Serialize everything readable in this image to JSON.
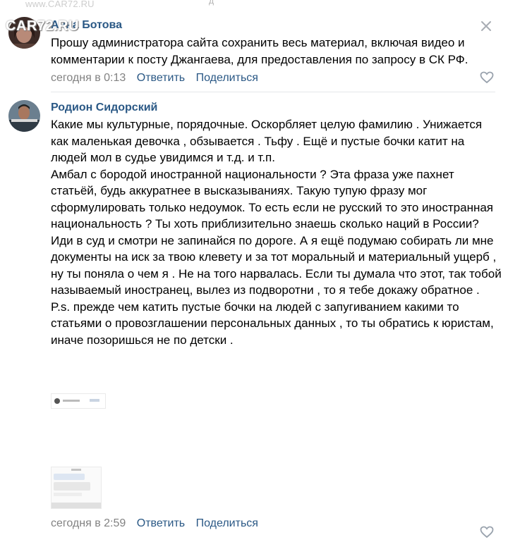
{
  "watermark": {
    "url": "www.CAR72.RU",
    "logo": "CAR72.RU"
  },
  "comments": [
    {
      "author": "Анна Ботова",
      "paragraphs": [
        "Прошу администратора сайта сохранить весь материал, включая видео и комментарии к посту Джангаева, для предоставления по запросу в СК РФ."
      ],
      "time": "сегодня в 0:13",
      "reply": "Ответить",
      "share": "Поделиться"
    },
    {
      "author": "Родион Сидорский",
      "paragraphs": [
        "Какие мы культурные, порядочные. Оскорбляет целую фамилию . Унижается как маленькая девочка , обзывается . Тьфу . Ещё и пустые бочки катит на людей мол в судье увидимся и т.д. и т.п.",
        "Амбал с бородой иностранной национальности ? Эта фраза уже пахнет статьёй, будь аккуратнее в высказываниях. Такую тупую фразу мог сформулировать только недоумок. То есть если не русский то это иностранная национальность ? Ты хоть приблизительно знаешь сколько наций в России?",
        "Иди в суд и смотри не запинайся по дороге. А я ещё подумаю собирать ли мне документы на иск за твою клевету и за тот моральный и материальный ущерб , ну ты поняла о чем я . Не на того нарвалась. Если ты думала что этот, так тобой называемый иностранец, вылез из подворотни , то я тебе докажу обратное .",
        "P.s. прежде чем катить пустые бочки на людей с запугиванием какими то статьями о провозглашении персональных данных , то ты обратись к юристам, иначе позоришься не по детски ."
      ],
      "time": "сегодня в 2:59",
      "reply": "Ответить",
      "share": "Поделиться",
      "attachments": [
        "screenshot-thumbnail-1",
        "screenshot-thumbnail-2"
      ]
    }
  ],
  "icons": {
    "close": "close-icon",
    "like": "heart-icon"
  },
  "colors": {
    "link": "#2a5885",
    "meta": "#828282",
    "divider": "#e4e6ea"
  }
}
